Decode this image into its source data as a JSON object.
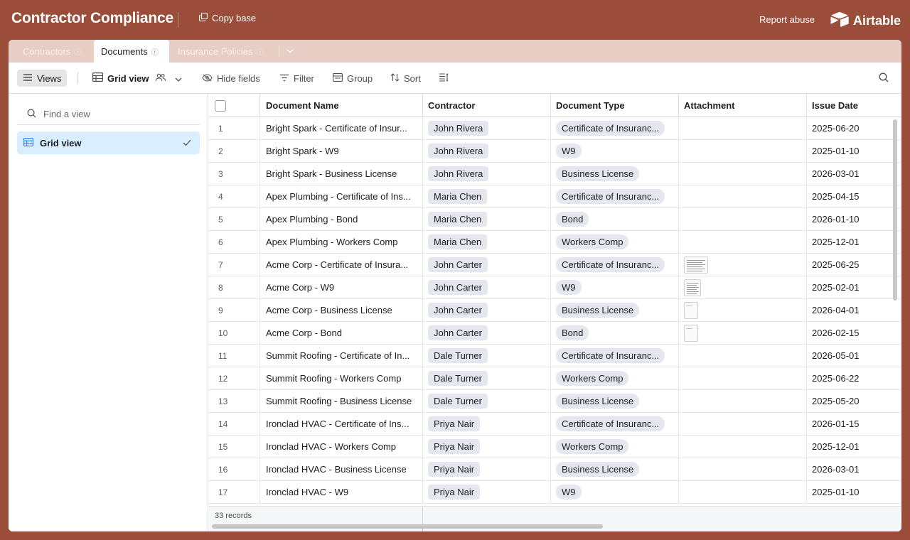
{
  "header": {
    "base_title": "Contractor Compliance",
    "copy_base": "Copy base",
    "report_abuse": "Report abuse",
    "brand": "Airtable"
  },
  "tabs": [
    {
      "label": "Contractors",
      "active": false
    },
    {
      "label": "Documents",
      "active": true
    },
    {
      "label": "Insurance Policies",
      "active": false
    }
  ],
  "toolbar": {
    "views": "Views",
    "grid_view": "Grid view",
    "hide_fields": "Hide fields",
    "filter": "Filter",
    "group": "Group",
    "sort": "Sort"
  },
  "sidebar": {
    "find_placeholder": "Find a view",
    "views": [
      {
        "label": "Grid view",
        "selected": true
      }
    ]
  },
  "grid": {
    "columns": [
      "Document Name",
      "Contractor",
      "Document Type",
      "Attachment",
      "Issue Date"
    ],
    "rows": [
      {
        "num": "1",
        "name": "Bright Spark - Certificate of Insur...",
        "contractor": "John Rivera",
        "type": "Certificate of Insuranc...",
        "attachment": "",
        "date": "2025-06-20"
      },
      {
        "num": "2",
        "name": "Bright Spark - W9",
        "contractor": "John Rivera",
        "type": "W9",
        "attachment": "",
        "date": "2025-01-10"
      },
      {
        "num": "3",
        "name": "Bright Spark - Business License",
        "contractor": "John Rivera",
        "type": "Business License",
        "attachment": "",
        "date": "2026-03-01"
      },
      {
        "num": "4",
        "name": "Apex Plumbing - Certificate of Ins...",
        "contractor": "Maria Chen",
        "type": "Certificate of Insuranc...",
        "attachment": "",
        "date": "2025-04-15"
      },
      {
        "num": "5",
        "name": "Apex Plumbing - Bond",
        "contractor": "Maria Chen",
        "type": "Bond",
        "attachment": "",
        "date": "2026-01-10"
      },
      {
        "num": "6",
        "name": "Apex Plumbing - Workers Comp",
        "contractor": "Maria Chen",
        "type": "Workers Comp",
        "attachment": "",
        "date": "2025-12-01"
      },
      {
        "num": "7",
        "name": "Acme Corp - Certificate of Insura...",
        "contractor": "John Carter",
        "type": "Certificate of Insuranc...",
        "attachment": "wide",
        "date": "2025-06-25"
      },
      {
        "num": "8",
        "name": "Acme Corp - W9",
        "contractor": "John Carter",
        "type": "W9",
        "attachment": "small",
        "date": "2025-02-01"
      },
      {
        "num": "9",
        "name": "Acme Corp - Business License",
        "contractor": "John Carter",
        "type": "Business License",
        "attachment": "tall",
        "date": "2026-04-01"
      },
      {
        "num": "10",
        "name": "Acme Corp - Bond",
        "contractor": "John Carter",
        "type": "Bond",
        "attachment": "tall",
        "date": "2026-02-15"
      },
      {
        "num": "11",
        "name": "Summit Roofing - Certificate of In...",
        "contractor": "Dale Turner",
        "type": "Certificate of Insuranc...",
        "attachment": "",
        "date": "2026-05-01"
      },
      {
        "num": "12",
        "name": "Summit Roofing - Workers Comp",
        "contractor": "Dale Turner",
        "type": "Workers Comp",
        "attachment": "",
        "date": "2025-06-22"
      },
      {
        "num": "13",
        "name": "Summit Roofing - Business License",
        "contractor": "Dale Turner",
        "type": "Business License",
        "attachment": "",
        "date": "2025-05-20"
      },
      {
        "num": "14",
        "name": "Ironclad HVAC - Certificate of Ins...",
        "contractor": "Priya Nair",
        "type": "Certificate of Insuranc...",
        "attachment": "",
        "date": "2026-01-15"
      },
      {
        "num": "15",
        "name": "Ironclad HVAC - Workers Comp",
        "contractor": "Priya Nair",
        "type": "Workers Comp",
        "attachment": "",
        "date": "2025-12-01"
      },
      {
        "num": "16",
        "name": "Ironclad HVAC - Business License",
        "contractor": "Priya Nair",
        "type": "Business License",
        "attachment": "",
        "date": "2026-03-01"
      },
      {
        "num": "17",
        "name": "Ironclad HVAC - W9",
        "contractor": "Priya Nair",
        "type": "W9",
        "attachment": "",
        "date": "2025-01-10"
      }
    ],
    "record_count": "33 records"
  }
}
